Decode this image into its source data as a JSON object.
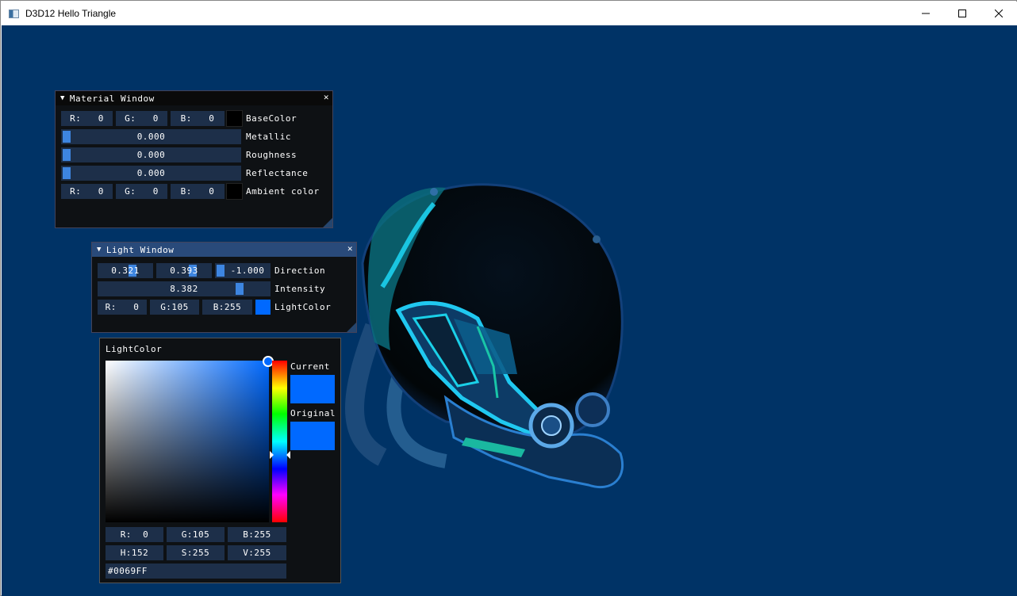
{
  "window": {
    "title": "D3D12 Hello Triangle"
  },
  "caption": {
    "minimize_glyph": "—",
    "maximize_glyph": "☐",
    "close_glyph": "✕"
  },
  "colors": {
    "scene_bg": "#003366",
    "light_color": "#0069ff",
    "imgui_frame": "#1d2f49",
    "imgui_grab": "#3d85e0"
  },
  "material_window": {
    "title": "Material Window",
    "close_glyph": "✕",
    "collapse_glyph": "▼",
    "base_color": {
      "r": "R:   0",
      "g": "G:   0",
      "b": "B:   0",
      "label": "BaseColor"
    },
    "metallic": {
      "value": "0.000",
      "label": "Metallic",
      "fraction": 0.0
    },
    "roughness": {
      "value": "0.000",
      "label": "Roughness",
      "fraction": 0.0
    },
    "reflectance": {
      "value": "0.000",
      "label": "Reflectance",
      "fraction": 0.0
    },
    "ambient_color": {
      "r": "R:   0",
      "g": "G:   0",
      "b": "B:   0",
      "label": "Ambient color"
    }
  },
  "light_window": {
    "title": "Light Window",
    "close_glyph": "✕",
    "collapse_glyph": "▼",
    "direction": {
      "x": "0.321",
      "y": "0.393",
      "z": "-1.000",
      "label": "Direction",
      "fractions": [
        0.66,
        0.7,
        0.0
      ]
    },
    "intensity": {
      "value": "8.382",
      "label": "Intensity",
      "fraction": 0.84
    },
    "light_color": {
      "r": "R:   0",
      "g": "G:105",
      "b": "B:255",
      "label": "LightColor"
    }
  },
  "color_picker": {
    "title": "LightColor",
    "current_label": "Current",
    "original_label": "Original",
    "rgb": {
      "r": "R:  0",
      "g": "G:105",
      "b": "B:255"
    },
    "hsv": {
      "h": "H:152",
      "s": "S:255",
      "v": "V:255"
    },
    "hex": "#0069FF"
  }
}
